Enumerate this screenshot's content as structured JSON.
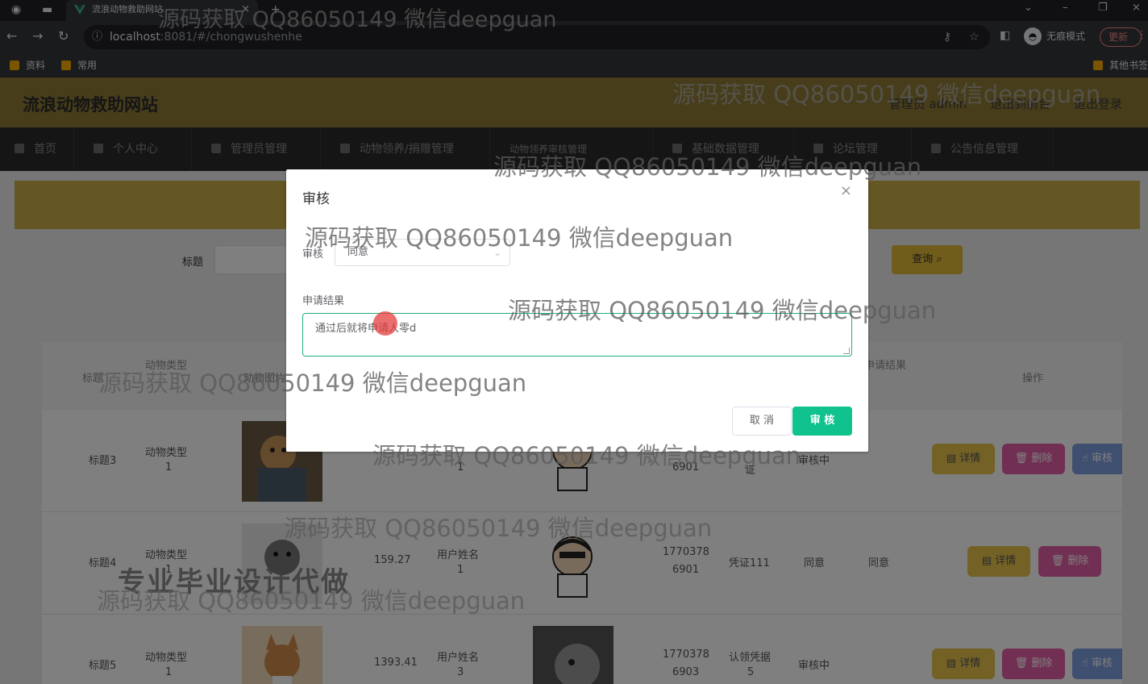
{
  "browser": {
    "tab_title": "流浪动物救助网站",
    "url_host": "localhost",
    "url_rest": ":8081/#/chongwushenhe",
    "incognito_label": "无痕模式",
    "update_label": "更新",
    "bookmarks": [
      "资料",
      "常用"
    ],
    "other_bookmarks": "其他书签"
  },
  "app": {
    "title": "流浪动物救助网站",
    "user_label": "管理员 admin",
    "back_link": "退出到前台",
    "logout_link": "退出登录"
  },
  "nav": [
    "首页",
    "个人中心",
    "管理员管理",
    "动物领养/捐赠管理",
    "动物领养审核管理",
    "基础数据管理",
    "论坛管理",
    "公告信息管理"
  ],
  "search": {
    "label": "标题",
    "query_button": "查询"
  },
  "table": {
    "headers": [
      "标题",
      "动物类型",
      "动物图片",
      "申请结果",
      "操作"
    ],
    "rows": [
      {
        "title": "标题3",
        "type_line1": "动物类型",
        "type_line2": "1",
        "price": "",
        "user_line1": "",
        "user_line2": "1",
        "phone_line1": "",
        "phone_line2": "6901",
        "proof": "证",
        "status": "审核中",
        "result": ""
      },
      {
        "title": "标题4",
        "type_line1": "动物类型",
        "type_line2": "1",
        "price": "159.27",
        "user_line1": "用户姓名",
        "user_line2": "1",
        "phone_line1": "1770378",
        "phone_line2": "6901",
        "proof": "凭证111",
        "status": "同意",
        "result": "同意"
      },
      {
        "title": "标题5",
        "type_line1": "动物类型",
        "type_line2": "1",
        "price": "1393.41",
        "user_line1": "用户姓名",
        "user_line2": "3",
        "phone_line1": "1770378",
        "phone_line2": "6903",
        "proof_line1": "认领凭据",
        "proof_line2": "5",
        "status": "审核中",
        "result": ""
      }
    ],
    "op_detail": "详情",
    "op_delete": "删除",
    "op_audit": "审核"
  },
  "dialog": {
    "title": "审核",
    "audit_label": "审核",
    "audit_value": "同意",
    "result_label": "申请结果",
    "result_value": "通过后就将申请人零d",
    "cancel": "取 消",
    "confirm": "审 核"
  },
  "watermark": {
    "text": "源码获取 QQ86050149 微信deepguan",
    "big": "专业毕业设计代做"
  },
  "colors": {
    "header": "#8f7a36",
    "confirm": "#10c28d",
    "textarea_border": "#20b07a"
  }
}
